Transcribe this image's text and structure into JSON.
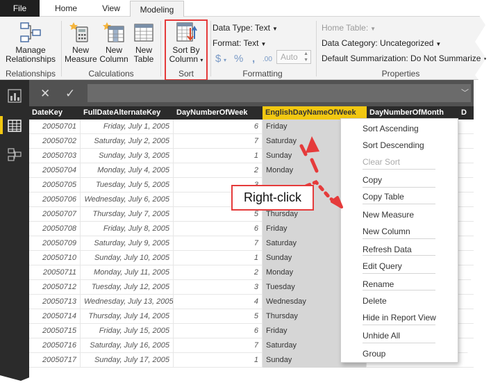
{
  "tabs": {
    "file": "File",
    "home": "Home",
    "view": "View",
    "modeling": "Modeling"
  },
  "ribbon": {
    "relationships": {
      "button": "Manage Relationships",
      "group": "Relationships"
    },
    "calculations": {
      "new_measure": "New Measure",
      "new_column": "New Column",
      "new_table": "New Table",
      "group": "Calculations"
    },
    "sort": {
      "button": "Sort By Column",
      "group": "Sort"
    },
    "formatting": {
      "data_type": "Data Type: Text",
      "format": "Format: Text",
      "currency_symbol": "$",
      "percent_symbol": "%",
      "comma_symbol": ",",
      "decimal_symbol": ".00",
      "auto_value": "Auto",
      "group": "Formatting"
    },
    "properties": {
      "home_table": "Home Table:",
      "data_category": "Data Category: Uncategorized",
      "default_summarization": "Default Summarization: Do Not Summarize",
      "group": "Properties"
    }
  },
  "formula_bar": {
    "cancel_icon": "close-icon",
    "commit_icon": "check-icon",
    "formula_value": ""
  },
  "table": {
    "columns": [
      "DateKey",
      "FullDateAlternateKey",
      "DayNumberOfWeek",
      "EnglishDayNameOfWeek",
      "DayNumberOfMonth",
      "D"
    ],
    "rows": [
      [
        "20050701",
        "Friday, July 1, 2005",
        "6",
        "Friday"
      ],
      [
        "20050702",
        "Saturday, July 2, 2005",
        "7",
        "Saturday"
      ],
      [
        "20050703",
        "Sunday, July 3, 2005",
        "1",
        "Sunday"
      ],
      [
        "20050704",
        "Monday, July 4, 2005",
        "2",
        "Monday"
      ],
      [
        "20050705",
        "Tuesday, July 5, 2005",
        "3",
        ""
      ],
      [
        "20050706",
        "Wednesday, July 6, 2005",
        "4",
        ""
      ],
      [
        "20050707",
        "Thursday, July 7, 2005",
        "5",
        "Thursday"
      ],
      [
        "20050708",
        "Friday, July 8, 2005",
        "6",
        "Friday"
      ],
      [
        "20050709",
        "Saturday, July 9, 2005",
        "7",
        "Saturday"
      ],
      [
        "20050710",
        "Sunday, July 10, 2005",
        "1",
        "Sunday"
      ],
      [
        "20050711",
        "Monday, July 11, 2005",
        "2",
        "Monday"
      ],
      [
        "20050712",
        "Tuesday, July 12, 2005",
        "3",
        "Tuesday"
      ],
      [
        "20050713",
        "Wednesday, July 13, 2005",
        "4",
        "Wednesday"
      ],
      [
        "20050714",
        "Thursday, July 14, 2005",
        "5",
        "Thursday"
      ],
      [
        "20050715",
        "Friday, July 15, 2005",
        "6",
        "Friday"
      ],
      [
        "20050716",
        "Saturday, July 16, 2005",
        "7",
        "Saturday"
      ],
      [
        "20050717",
        "Sunday, July 17, 2005",
        "1",
        "Sunday"
      ]
    ]
  },
  "context_menu": {
    "items": [
      {
        "label": "Sort Ascending",
        "enabled": true
      },
      {
        "label": "Sort Descending",
        "enabled": true
      },
      {
        "label": "Clear Sort",
        "enabled": false
      },
      {
        "label": "Copy",
        "enabled": true
      },
      {
        "label": "Copy Table",
        "enabled": true
      },
      {
        "label": "New Measure",
        "enabled": true
      },
      {
        "label": "New Column",
        "enabled": true
      },
      {
        "label": "Refresh Data",
        "enabled": true
      },
      {
        "label": "Edit Query",
        "enabled": true
      },
      {
        "label": "Rename",
        "enabled": true
      },
      {
        "label": "Delete",
        "enabled": true
      },
      {
        "label": "Hide in Report View",
        "enabled": true
      },
      {
        "label": "Unhide All",
        "enabled": true
      },
      {
        "label": "Group",
        "enabled": true
      }
    ]
  },
  "annotation": {
    "callout": "Right-click"
  },
  "colors": {
    "highlight_red": "#e53b3b",
    "selected_header": "#f2c811",
    "dark_chrome": "#2b2b2b"
  }
}
